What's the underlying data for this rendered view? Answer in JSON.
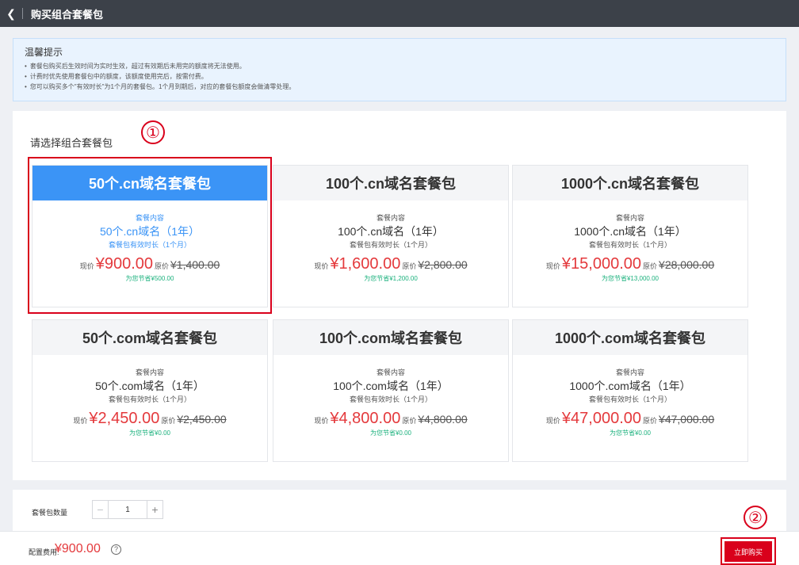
{
  "header": {
    "back_icon": "chevron-left-icon",
    "title": "购买组合套餐包"
  },
  "notice": {
    "title": "温馨提示",
    "items": [
      "套餐包购买后生效时间为实时生效，超过有效期后未用完的额度将无法使用。",
      "计费时优先使用套餐包中的额度，该额度使用完后，按需付费。",
      "您可以购买多个\"有效时长\"为1个月的套餐包。1个月到期后，对应的套餐包额度会做清零处理。"
    ]
  },
  "section": {
    "label": "请选择组合套餐包"
  },
  "markers": {
    "one": "①",
    "two": "②"
  },
  "cards": [
    {
      "title": "50个.cn域名套餐包",
      "content_label": "套餐内容",
      "domains": "50个.cn域名（1年）",
      "validity": "套餐包有效时长（1个月）",
      "now_label": "现价",
      "price": "¥900.00",
      "orig_label": "原价",
      "orig_price": "¥1,400.00",
      "saving": "为您节省¥500.00",
      "selected": true
    },
    {
      "title": "100个.cn域名套餐包",
      "content_label": "套餐内容",
      "domains": "100个.cn域名（1年）",
      "validity": "套餐包有效时长（1个月）",
      "now_label": "现价",
      "price": "¥1,600.00",
      "orig_label": "原价",
      "orig_price": "¥2,800.00",
      "saving": "为您节省¥1,200.00",
      "selected": false
    },
    {
      "title": "1000个.cn域名套餐包",
      "content_label": "套餐内容",
      "domains": "1000个.cn域名（1年）",
      "validity": "套餐包有效时长（1个月）",
      "now_label": "现价",
      "price": "¥15,000.00",
      "orig_label": "原价",
      "orig_price": "¥28,000.00",
      "saving": "为您节省¥13,000.00",
      "selected": false
    },
    {
      "title": "50个.com域名套餐包",
      "content_label": "套餐内容",
      "domains": "50个.com域名（1年）",
      "validity": "套餐包有效时长（1个月）",
      "now_label": "现价",
      "price": "¥2,450.00",
      "orig_label": "原价",
      "orig_price": "¥2,450.00",
      "saving": "为您节省¥0.00",
      "selected": false
    },
    {
      "title": "100个.com域名套餐包",
      "content_label": "套餐内容",
      "domains": "100个.com域名（1年）",
      "validity": "套餐包有效时长（1个月）",
      "now_label": "现价",
      "price": "¥4,800.00",
      "orig_label": "原价",
      "orig_price": "¥4,800.00",
      "saving": "为您节省¥0.00",
      "selected": false
    },
    {
      "title": "1000个.com域名套餐包",
      "content_label": "套餐内容",
      "domains": "1000个.com域名（1年）",
      "validity": "套餐包有效时长（1个月）",
      "now_label": "现价",
      "price": "¥47,000.00",
      "orig_label": "原价",
      "orig_price": "¥47,000.00",
      "saving": "为您节省¥0.00",
      "selected": false
    }
  ],
  "quantity": {
    "label": "套餐包数量",
    "value": "1",
    "minus": "−",
    "plus": "+"
  },
  "footer": {
    "fee_label": "配置费用:",
    "fee": "¥900.00",
    "help_icon": "question-circle-icon",
    "help_glyph": "?",
    "buy_label": "立即购买"
  },
  "colors": {
    "accent_blue": "#3b94f6",
    "price_red": "#e4393c",
    "highlight_red": "#d9001b",
    "saving_green": "#1bb17d",
    "topbar": "#3c4149"
  }
}
